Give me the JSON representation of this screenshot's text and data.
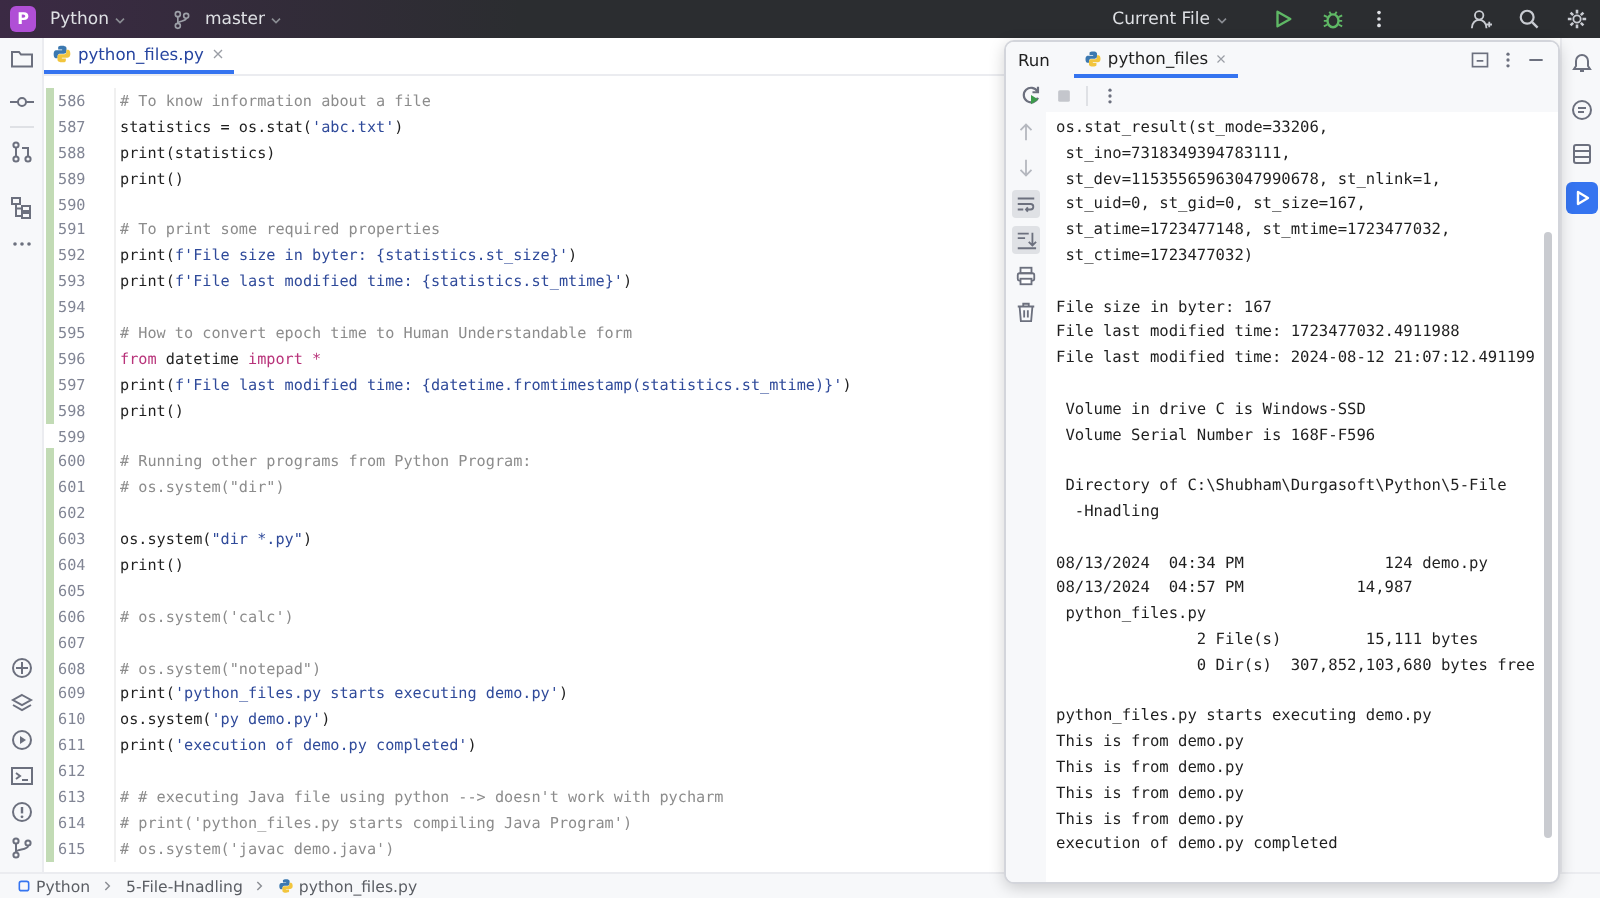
{
  "title_bar": {
    "project_badge": "P",
    "project": "Python",
    "branch": "master",
    "run_config": "Current File"
  },
  "left_strip": {
    "top": [
      {
        "kind": "folder",
        "selected": false
      },
      {
        "kind": "commit",
        "selected": false
      },
      {
        "kind": "pull-request",
        "selected": false
      },
      {
        "kind": "structure",
        "selected": false
      },
      {
        "kind": "more",
        "selected": false
      }
    ],
    "bottom": [
      {
        "kind": "python-packages",
        "selected": false
      },
      {
        "kind": "layers",
        "selected": false
      },
      {
        "kind": "services",
        "selected": false
      },
      {
        "kind": "terminal",
        "selected": false
      },
      {
        "kind": "problems",
        "selected": false
      },
      {
        "kind": "git",
        "selected": false
      }
    ]
  },
  "right_strip": [
    {
      "kind": "bell",
      "selected": false
    },
    {
      "kind": "console",
      "selected": false
    },
    {
      "kind": "database",
      "selected": false
    },
    {
      "kind": "run",
      "selected": true
    }
  ],
  "editor": {
    "tabs": [
      {
        "label": "python_files.py",
        "selected": true,
        "closable": true
      }
    ],
    "lines": [
      {
        "number": "586",
        "changed": true,
        "tokens": [
          {
            "kind": "comment",
            "text": "# To know information about a file"
          }
        ]
      },
      {
        "number": "587",
        "changed": true,
        "tokens": [
          {
            "kind": "plain",
            "text": "statistics = os.stat("
          },
          {
            "kind": "string",
            "text": "'abc.txt'"
          },
          {
            "kind": "plain",
            "text": ")"
          }
        ]
      },
      {
        "number": "588",
        "changed": true,
        "tokens": [
          {
            "kind": "plain",
            "text": "print(statistics)"
          }
        ]
      },
      {
        "number": "589",
        "changed": true,
        "tokens": [
          {
            "kind": "plain",
            "text": "print()"
          }
        ]
      },
      {
        "number": "590",
        "changed": true
      },
      {
        "number": "591",
        "changed": true,
        "tokens": [
          {
            "kind": "comment",
            "text": "# To print some required properties"
          }
        ]
      },
      {
        "number": "592",
        "changed": true,
        "tokens": [
          {
            "kind": "plain",
            "text": "print("
          },
          {
            "kind": "string",
            "text": "f'File size in byter: {statistics.st_size}'"
          },
          {
            "kind": "plain",
            "text": ")"
          }
        ]
      },
      {
        "number": "593",
        "changed": true,
        "tokens": [
          {
            "kind": "plain",
            "text": "print("
          },
          {
            "kind": "string",
            "text": "f'File last modified time: {statistics.st_mtime}'"
          },
          {
            "kind": "plain",
            "text": ")"
          }
        ]
      },
      {
        "number": "594",
        "changed": true
      },
      {
        "number": "595",
        "changed": true,
        "tokens": [
          {
            "kind": "comment",
            "text": "# How to convert epoch time to Human Understandable form"
          }
        ]
      },
      {
        "number": "596",
        "changed": true,
        "tokens": [
          {
            "kind": "keyword",
            "text": "from"
          },
          {
            "kind": "plain",
            "text": " datetime "
          },
          {
            "kind": "keyword",
            "text": "import *"
          }
        ]
      },
      {
        "number": "597",
        "changed": true,
        "tokens": [
          {
            "kind": "plain",
            "text": "print("
          },
          {
            "kind": "string",
            "text": "f'File last modified time: {datetime.fromtimestamp(statistics.st_mtime)}'"
          },
          {
            "kind": "plain",
            "text": ")"
          }
        ]
      },
      {
        "number": "598",
        "changed": true,
        "tokens": [
          {
            "kind": "plain",
            "text": "print()"
          }
        ]
      },
      {
        "number": "599",
        "changed": false
      },
      {
        "number": "600",
        "changed": true,
        "tokens": [
          {
            "kind": "comment",
            "text": "# Running other programs from Python Program:"
          }
        ]
      },
      {
        "number": "601",
        "changed": true,
        "tokens": [
          {
            "kind": "comment",
            "text": "# os.system(\"dir\")"
          }
        ]
      },
      {
        "number": "602",
        "changed": true
      },
      {
        "number": "603",
        "changed": true,
        "tokens": [
          {
            "kind": "plain",
            "text": "os.system("
          },
          {
            "kind": "string",
            "text": "\"dir *.py\""
          },
          {
            "kind": "plain",
            "text": ")"
          }
        ]
      },
      {
        "number": "604",
        "changed": true,
        "tokens": [
          {
            "kind": "plain",
            "text": "print()"
          }
        ]
      },
      {
        "number": "605",
        "changed": true
      },
      {
        "number": "606",
        "changed": true,
        "tokens": [
          {
            "kind": "comment",
            "text": "# os.system('calc')"
          }
        ]
      },
      {
        "number": "607",
        "changed": true
      },
      {
        "number": "608",
        "changed": true,
        "tokens": [
          {
            "kind": "comment",
            "text": "# os.system(\"notepad\")"
          }
        ]
      },
      {
        "number": "609",
        "changed": true,
        "tokens": [
          {
            "kind": "plain",
            "text": "print("
          },
          {
            "kind": "string",
            "text": "'python_files.py starts executing demo.py'"
          },
          {
            "kind": "plain",
            "text": ")"
          }
        ]
      },
      {
        "number": "610",
        "changed": true,
        "tokens": [
          {
            "kind": "plain",
            "text": "os.system("
          },
          {
            "kind": "string",
            "text": "'py demo.py'"
          },
          {
            "kind": "plain",
            "text": ")"
          }
        ]
      },
      {
        "number": "611",
        "changed": true,
        "tokens": [
          {
            "kind": "plain",
            "text": "print("
          },
          {
            "kind": "string",
            "text": "'execution of demo.py completed'"
          },
          {
            "kind": "plain",
            "text": ")"
          }
        ]
      },
      {
        "number": "612",
        "changed": true
      },
      {
        "number": "613",
        "changed": true,
        "tokens": [
          {
            "kind": "comment",
            "text": "# # executing Java file using python --> doesn't work with pycharm"
          }
        ]
      },
      {
        "number": "614",
        "changed": true,
        "tokens": [
          {
            "kind": "comment",
            "text": "# print('python_files.py starts compiling Java Program')"
          }
        ]
      },
      {
        "number": "615",
        "changed": true,
        "tokens": [
          {
            "kind": "comment",
            "text": "# os.system('javac demo.java')"
          }
        ]
      }
    ]
  },
  "run_panel": {
    "title": "Run",
    "tabs": [
      {
        "label": "python_files",
        "selected": true,
        "closable": true
      }
    ],
    "console_tools": [
      {
        "kind": "up",
        "selected": false
      },
      {
        "kind": "down",
        "selected": false
      },
      {
        "kind": "soft-wrap",
        "selected": true
      },
      {
        "kind": "scroll-end",
        "selected": true
      },
      {
        "kind": "print",
        "selected": false
      },
      {
        "kind": "trash",
        "selected": false
      }
    ],
    "output": [
      {
        "lines": [
          "os.stat_result(st_mode=33206,",
          " st_ino=7318349394783111,",
          " st_dev=11535565963047990678, st_nlink=1,",
          " st_uid=0, st_gid=0, st_size=167,",
          " st_atime=1723477148, st_mtime=1723477032,",
          " st_ctime=1723477032)"
        ]
      },
      {
        "lines": [
          "File size in byter: 167",
          "File last modified time: 1723477032.4911988",
          "File last modified time: 2024-08-12 21:07:12.491199"
        ]
      },
      {
        "lines": [
          " Volume in drive C is Windows-SSD",
          " Volume Serial Number is 168F-F596"
        ]
      },
      {
        "lines": [
          " Directory of C:\\Shubham\\Durgasoft\\Python\\5-File",
          "  -Hnadling"
        ]
      },
      {
        "lines": [
          "08/13/2024  04:34 PM               124 demo.py",
          "08/13/2024  04:57 PM            14,987",
          " python_files.py",
          "               2 File(s)         15,111 bytes",
          "               0 Dir(s)  307,852,103,680 bytes free"
        ]
      },
      {
        "lines": [
          "python_files.py starts executing demo.py",
          "This is from demo.py",
          "This is from demo.py",
          "This is from demo.py",
          "This is from demo.py",
          "execution of demo.py completed"
        ]
      }
    ]
  },
  "breadcrumbs": [
    {
      "kind": "project",
      "label": "Python"
    },
    {
      "kind": "folder",
      "label": "5-File-Hnadling"
    },
    {
      "kind": "python-file",
      "label": "python_files.py"
    }
  ]
}
